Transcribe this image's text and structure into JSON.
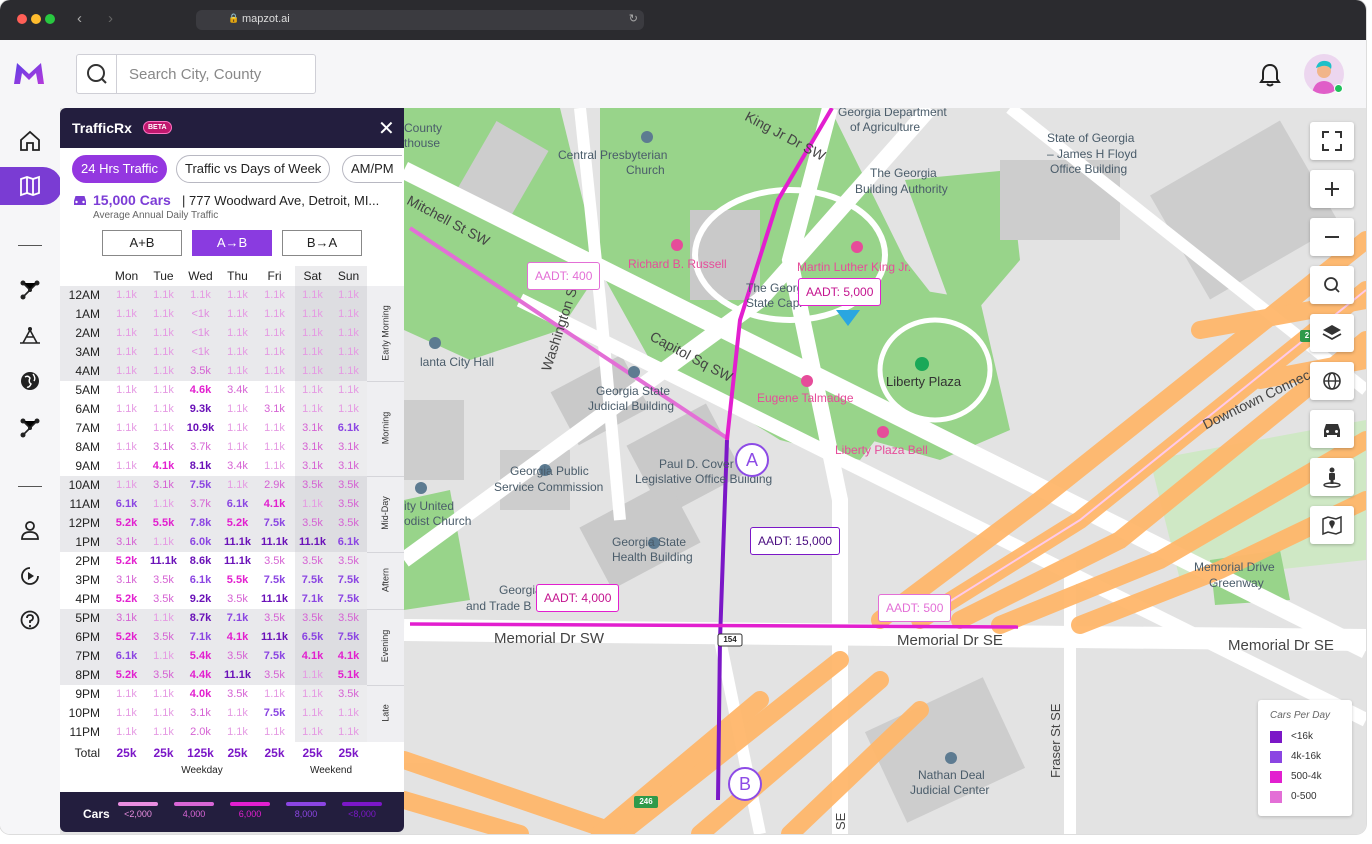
{
  "browser": {
    "url": "mapzot.ai"
  },
  "header": {
    "search_placeholder": "Search City, County"
  },
  "icons": {
    "logo": "mapzot-logo",
    "search": "search-icon",
    "bell": "bell-icon",
    "nav": [
      "home-icon",
      "map-icon",
      "network-icon",
      "tower-icon",
      "globe-icon",
      "route-icon",
      "user-icon",
      "play-icon",
      "help-icon"
    ],
    "map_controls": [
      "fullscreen-icon",
      "zoom-in-icon",
      "zoom-out-icon",
      "search-icon",
      "layers-icon",
      "globe-icon",
      "car-icon",
      "street-view-icon",
      "map-pin-icon"
    ]
  },
  "colors": {
    "accent": "#7a3cd3",
    "panel_header": "#231e3e",
    "road_purple": "#7b17c7",
    "road_magenta": "#e21fcf",
    "road_pink": "#e36fd6"
  },
  "panel": {
    "title": "TrafficRx",
    "badge": "BETA",
    "tabs": [
      "24 Hrs Traffic",
      "Traffic vs Days of Week",
      "AM/PM"
    ],
    "active_tab": "24 Hrs Traffic",
    "count": "15,000 Cars",
    "address": "| 777 Woodward Ave, Detroit, MI...",
    "subtitle": "Average Annual Daily Traffic",
    "directions": [
      "A+B",
      "A→B",
      "B→A"
    ],
    "active_direction": "A→B",
    "days": [
      "Mon",
      "Tue",
      "Wed",
      "Thu",
      "Fri",
      "Sat",
      "Sun"
    ],
    "weekday_label": "Weekday",
    "weekend_label": "Weekend",
    "total_label": "Total",
    "totals": [
      "25k",
      "25k",
      "125k",
      "25k",
      "25k",
      "25k",
      "25k"
    ],
    "segments": [
      "Early Morning",
      "Morning",
      "Mid-Day",
      "Aftern",
      "Evening",
      "Late"
    ],
    "hours": [
      {
        "h": "12AM",
        "v": [
          "1.1k",
          "1.1k",
          "1.1k",
          "1.1k",
          "1.1k",
          "1.1k",
          "1.1k"
        ]
      },
      {
        "h": "1AM",
        "v": [
          "1.1k",
          "1.1k",
          "<1k",
          "1.1k",
          "1.1k",
          "1.1k",
          "1.1k"
        ]
      },
      {
        "h": "2AM",
        "v": [
          "1.1k",
          "1.1k",
          "<1k",
          "1.1k",
          "1.1k",
          "1.1k",
          "1.1k"
        ]
      },
      {
        "h": "3AM",
        "v": [
          "1.1k",
          "1.1k",
          "<1k",
          "1.1k",
          "1.1k",
          "1.1k",
          "1.1k"
        ]
      },
      {
        "h": "4AM",
        "v": [
          "1.1k",
          "1.1k",
          "3.5k",
          "1.1k",
          "1.1k",
          "1.1k",
          "1.1k"
        ]
      },
      {
        "h": "5AM",
        "v": [
          "1.1k",
          "1.1k",
          "4.6k",
          "3.4k",
          "1.1k",
          "1.1k",
          "1.1k"
        ]
      },
      {
        "h": "6AM",
        "v": [
          "1.1k",
          "1.1k",
          "9.3k",
          "1.1k",
          "3.1k",
          "1.1k",
          "1.1k"
        ]
      },
      {
        "h": "7AM",
        "v": [
          "1.1k",
          "1.1k",
          "10.9k",
          "1.1k",
          "1.1k",
          "3.1k",
          "6.1k"
        ]
      },
      {
        "h": "8AM",
        "v": [
          "1.1k",
          "3.1k",
          "3.7k",
          "1.1k",
          "1.1k",
          "3.1k",
          "3.1k"
        ]
      },
      {
        "h": "9AM",
        "v": [
          "1.1k",
          "4.1k",
          "8.1k",
          "3.4k",
          "1.1k",
          "3.1k",
          "3.1k"
        ]
      },
      {
        "h": "10AM",
        "v": [
          "1.1k",
          "3.1k",
          "7.5k",
          "1.1k",
          "2.9k",
          "3.5k",
          "3.5k"
        ]
      },
      {
        "h": "11AM",
        "v": [
          "6.1k",
          "1.1k",
          "3.7k",
          "6.1k",
          "4.1k",
          "1.1k",
          "3.5k"
        ]
      },
      {
        "h": "12PM",
        "v": [
          "5.2k",
          "5.5k",
          "7.8k",
          "5.2k",
          "7.5k",
          "3.5k",
          "3.5k"
        ]
      },
      {
        "h": "1PM",
        "v": [
          "3.1k",
          "1.1k",
          "6.0k",
          "11.1k",
          "11.1k",
          "11.1k",
          "6.1k"
        ]
      },
      {
        "h": "2PM",
        "v": [
          "5.2k",
          "11.1k",
          "8.6k",
          "11.1k",
          "3.5k",
          "3.5k",
          "3.5k"
        ]
      },
      {
        "h": "3PM",
        "v": [
          "3.1k",
          "3.5k",
          "6.1k",
          "5.5k",
          "7.5k",
          "7.5k",
          "7.5k"
        ]
      },
      {
        "h": "4PM",
        "v": [
          "5.2k",
          "3.5k",
          "9.2k",
          "3.5k",
          "11.1k",
          "7.1k",
          "7.5k"
        ]
      },
      {
        "h": "5PM",
        "v": [
          "3.1k",
          "1.1k",
          "8.7k",
          "7.1k",
          "3.5k",
          "3.5k",
          "3.5k"
        ]
      },
      {
        "h": "6PM",
        "v": [
          "5.2k",
          "3.5k",
          "7.1k",
          "4.1k",
          "11.1k",
          "6.5k",
          "7.5k"
        ]
      },
      {
        "h": "7PM",
        "v": [
          "6.1k",
          "1.1k",
          "5.4k",
          "3.5k",
          "7.5k",
          "4.1k",
          "4.1k"
        ]
      },
      {
        "h": "8PM",
        "v": [
          "5.2k",
          "3.5k",
          "4.4k",
          "11.1k",
          "3.5k",
          "1.1k",
          "5.1k"
        ]
      },
      {
        "h": "9PM",
        "v": [
          "1.1k",
          "1.1k",
          "4.0k",
          "3.5k",
          "1.1k",
          "1.1k",
          "3.5k"
        ]
      },
      {
        "h": "10PM",
        "v": [
          "1.1k",
          "1.1k",
          "3.1k",
          "1.1k",
          "7.5k",
          "1.1k",
          "1.1k"
        ]
      },
      {
        "h": "11PM",
        "v": [
          "1.1k",
          "1.1k",
          "2.0k",
          "1.1k",
          "1.1k",
          "1.1k",
          "1.1k"
        ]
      }
    ],
    "cars_legend": {
      "label": "Cars",
      "items": [
        {
          "text": "<2,000",
          "color": "#e98ee0"
        },
        {
          "text": "4,000",
          "color": "#d966d6"
        },
        {
          "text": "6,000",
          "color": "#e21fcf"
        },
        {
          "text": "8,000",
          "color": "#8b45e2"
        },
        {
          "text": "<8,000",
          "color": "#7b17c7"
        }
      ]
    }
  },
  "map": {
    "aadt": [
      {
        "text": "AADT: 400"
      },
      {
        "text": "AADT: 5,000"
      },
      {
        "text": "AADT: 15,000"
      },
      {
        "text": "AADT: 4,000"
      },
      {
        "text": "AADT: 500"
      }
    ],
    "markers": [
      "A",
      "B"
    ],
    "labels": [
      "County",
      "thouse",
      "Central Presbyterian",
      "Church",
      "Georgia Department",
      "of Agriculture",
      "State of Georgia",
      "– James H Floyd",
      "Office Building",
      "The Georgia",
      "Building Authority",
      "Richard B. Russell",
      "Martin Luther King Jr.",
      "The Georgi",
      "State Capi",
      "lanta City Hall",
      "Georgia State",
      "Judicial Building",
      "Eugene Talmadge",
      "Liberty Plaza",
      "Liberty Plaza Bell",
      "Paul D. Cover",
      "Legislative Office Building",
      "Georgia Public",
      "Service Commission",
      "ity United",
      "odist Church",
      "Georgia State",
      "Health Building",
      "Georgia Rev",
      "and Trade B",
      "Memorial Drive",
      "Greenway",
      "Nathan Deal",
      "Judicial Center"
    ],
    "streets": [
      "Mitchell St SW",
      "Washington St",
      "Capitol Sq SW",
      "King Jr Dr SW",
      "Downtown Connec",
      "Memorial Dr SW",
      "Memorial Dr SE",
      "Memorial Dr SE",
      "Fraser St SE",
      "SE"
    ],
    "shields": [
      "154",
      "246",
      "2"
    ]
  },
  "legend": {
    "title": "Cars Per Day",
    "items": [
      {
        "text": "<16k",
        "color": "#7b17c7"
      },
      {
        "text": "4k-16k",
        "color": "#8b45e2"
      },
      {
        "text": "500-4k",
        "color": "#e21fcf"
      },
      {
        "text": "0-500",
        "color": "#e36fd6"
      }
    ]
  }
}
